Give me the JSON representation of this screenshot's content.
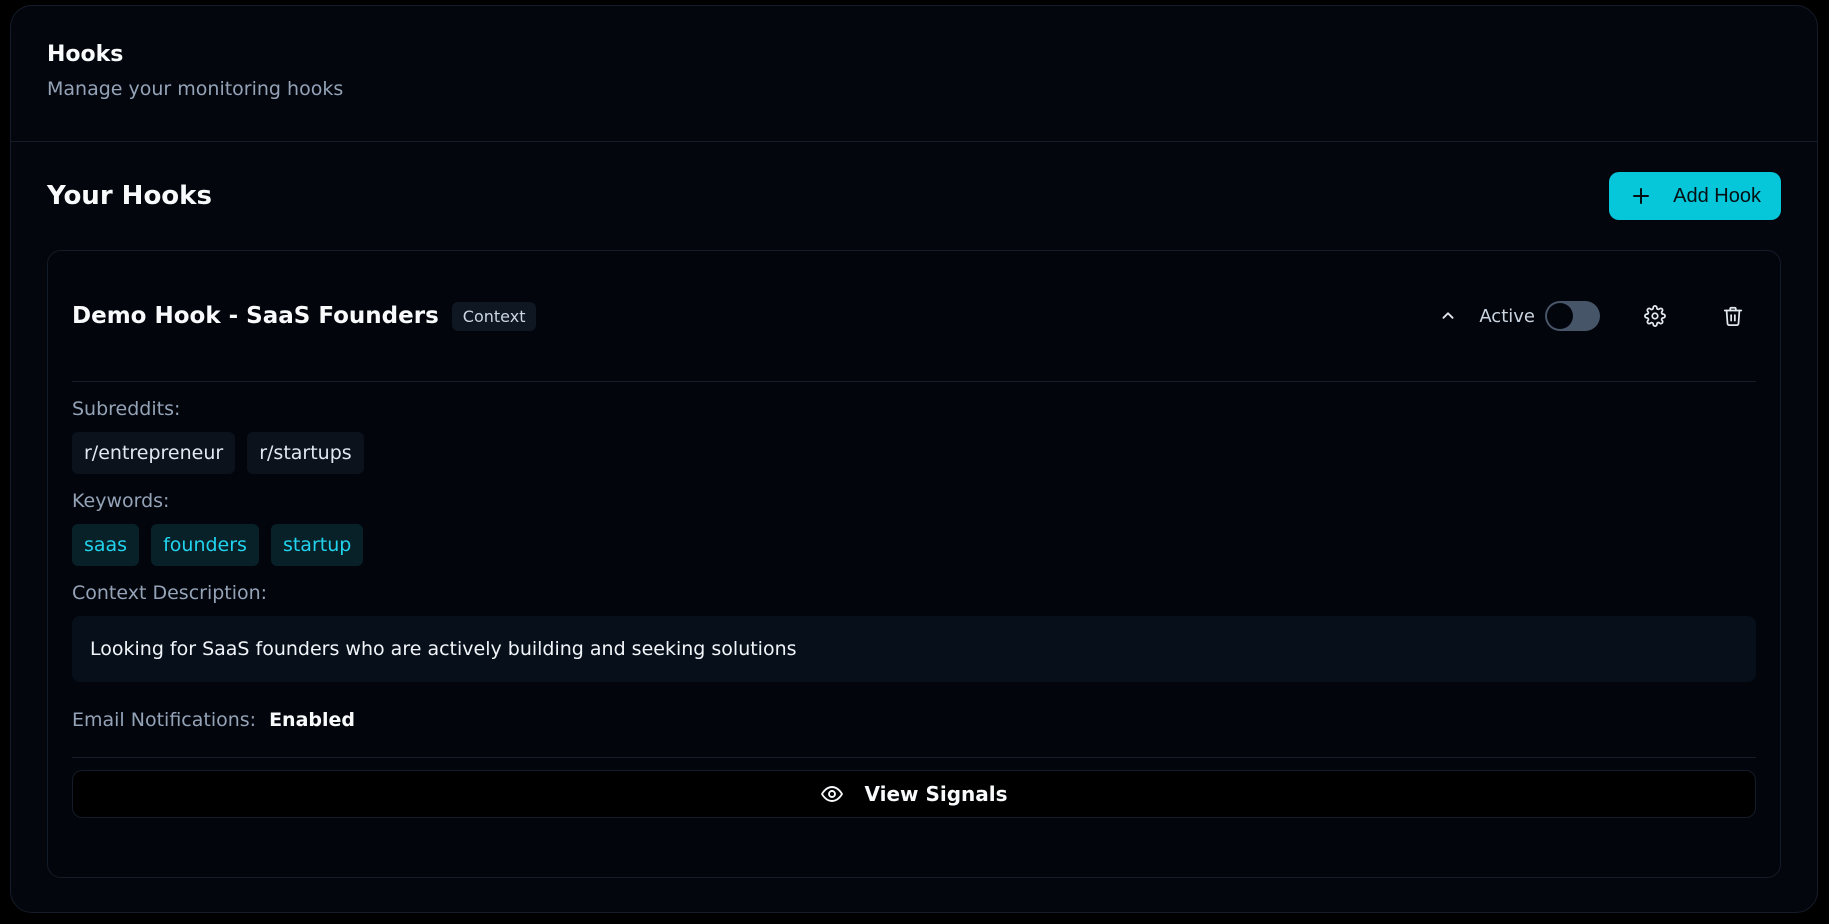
{
  "page": {
    "title": "Hooks",
    "subtitle": "Manage your monitoring hooks"
  },
  "section": {
    "title": "Your Hooks",
    "add_button_label": "Add Hook"
  },
  "hook": {
    "name": "Demo Hook - SaaS Founders",
    "badge": "Context",
    "status_label": "Active",
    "active": false,
    "subreddits_label": "Subreddits:",
    "subreddits": [
      "r/entrepreneur",
      "r/startups"
    ],
    "keywords_label": "Keywords:",
    "keywords": [
      "saas",
      "founders",
      "startup"
    ],
    "context_label": "Context Description:",
    "context_description": "Looking for SaaS founders who are actively building and seeking solutions",
    "email_label": "Email Notifications:",
    "email_value": "Enabled",
    "view_button_label": "View Signals"
  },
  "colors": {
    "accent": "#06c7d9",
    "keyword_text": "#22d3ee",
    "background": "#03060d"
  },
  "icons": {
    "add": "plus-icon",
    "collapse": "chevron-up-icon",
    "settings": "gear-icon",
    "delete": "trash-icon",
    "view": "eye-icon"
  }
}
